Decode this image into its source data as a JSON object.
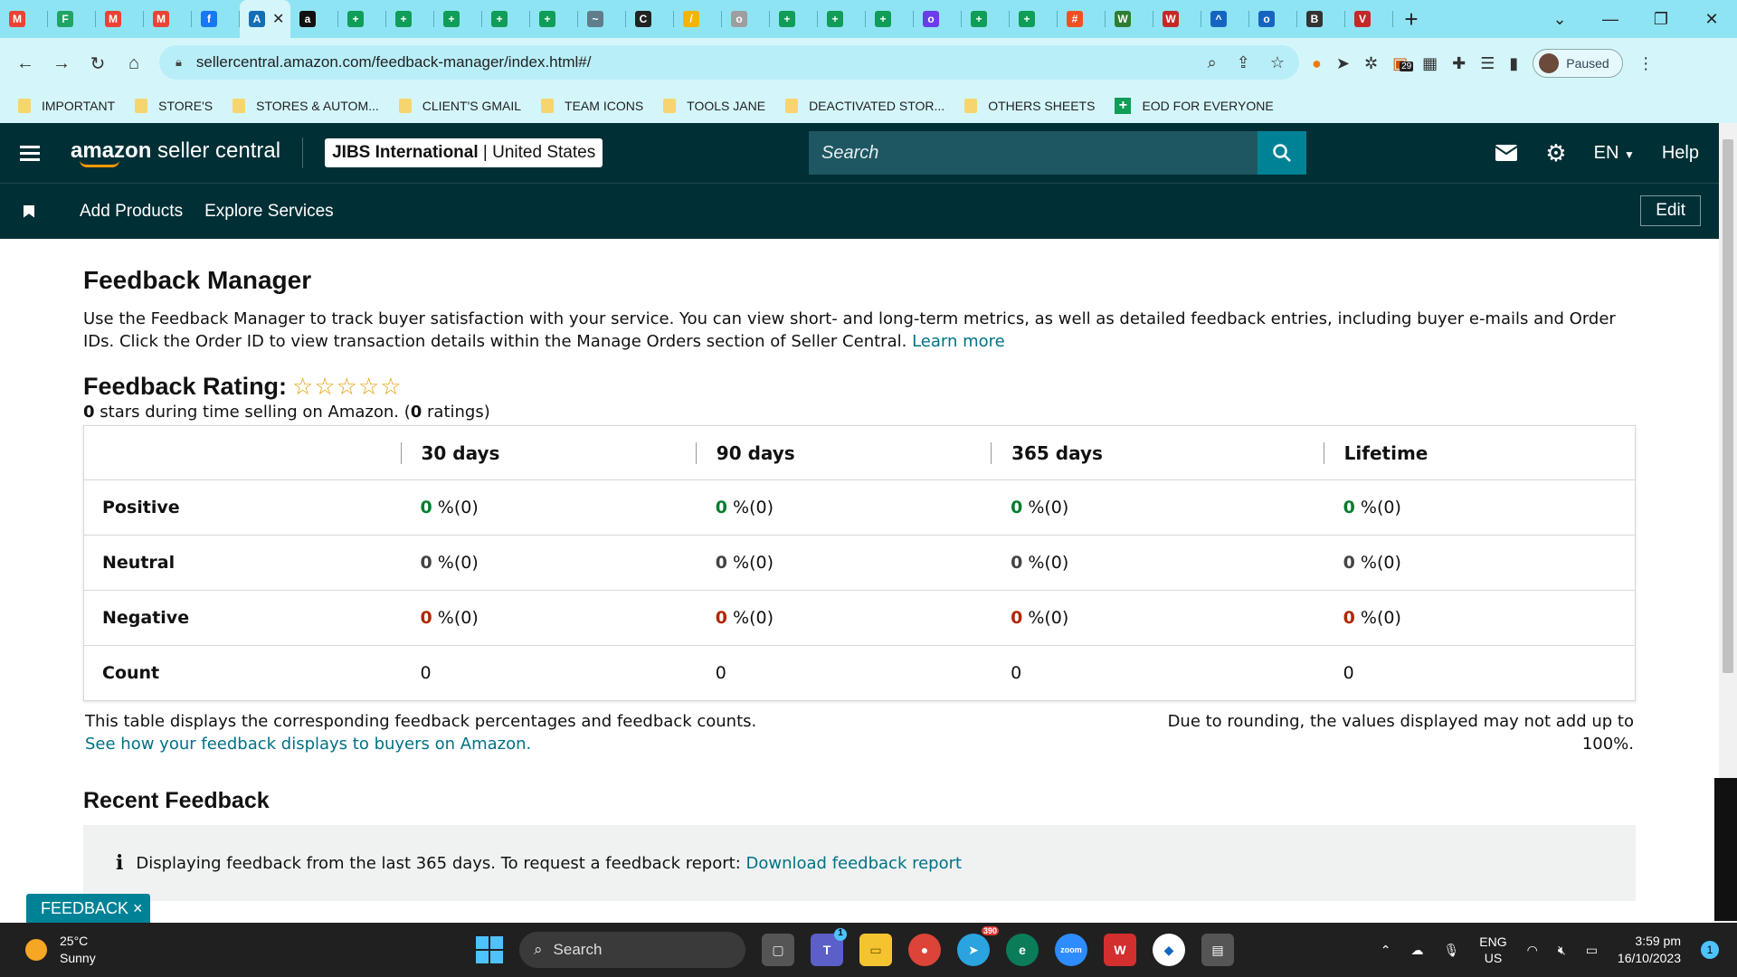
{
  "browser": {
    "tabs": [
      {
        "icon": "gmail-icon",
        "label": "M",
        "color": "#ea4335"
      },
      {
        "icon": "drive-icon",
        "label": "F",
        "color": "#1fa463"
      },
      {
        "icon": "gmail-icon",
        "label": "M",
        "color": "#ea4335"
      },
      {
        "icon": "gmail-icon",
        "label": "M",
        "color": "#ea4335"
      },
      {
        "icon": "facebook-icon",
        "label": "f",
        "color": "#1877f2"
      },
      {
        "icon": "amazon-icon",
        "label": "A",
        "color": "#146eb4",
        "active": true
      },
      {
        "icon": "amazon-a-icon",
        "label": "a",
        "color": "#111111"
      },
      {
        "icon": "sheets-icon",
        "label": "+",
        "color": "#0f9d58"
      },
      {
        "icon": "sheets-icon",
        "label": "+",
        "color": "#0f9d58"
      },
      {
        "icon": "sheets-icon",
        "label": "+",
        "color": "#0f9d58"
      },
      {
        "icon": "sheets-icon",
        "label": "+",
        "color": "#0f9d58"
      },
      {
        "icon": "sheets-icon",
        "label": "+",
        "color": "#0f9d58"
      },
      {
        "icon": "cloud-icon",
        "label": "~",
        "color": "#607d8b"
      },
      {
        "icon": "circle-c-icon",
        "label": "C",
        "color": "#222222"
      },
      {
        "icon": "pen-icon",
        "label": "/",
        "color": "#f4b400"
      },
      {
        "icon": "globe-icon",
        "label": "o",
        "color": "#9e9e9e"
      },
      {
        "icon": "sheets-icon",
        "label": "+",
        "color": "#0f9d58"
      },
      {
        "icon": "sheets-icon",
        "label": "+",
        "color": "#0f9d58"
      },
      {
        "icon": "sheets-icon",
        "label": "+",
        "color": "#0f9d58"
      },
      {
        "icon": "chat-icon",
        "label": "o",
        "color": "#6a3de8"
      },
      {
        "icon": "sheets-icon",
        "label": "+",
        "color": "#0f9d58"
      },
      {
        "icon": "sheets-icon",
        "label": "+",
        "color": "#0f9d58"
      },
      {
        "icon": "microsoft-icon",
        "label": "#",
        "color": "#f25022"
      },
      {
        "icon": "w-icon",
        "label": "W",
        "color": "#2e7d32"
      },
      {
        "icon": "vw-icon",
        "label": "W",
        "color": "#c62828"
      },
      {
        "icon": "cap-icon",
        "label": "^",
        "color": "#1565c0"
      },
      {
        "icon": "eye-icon",
        "label": "o",
        "color": "#1565c0"
      },
      {
        "icon": "b-icon",
        "label": "B",
        "color": "#333333"
      },
      {
        "icon": "v-icon",
        "label": "V",
        "color": "#c62828"
      }
    ],
    "address": {
      "url": "sellercentral.amazon.com/feedback-manager/index.html#/"
    },
    "profile_label": "Paused",
    "ext_badge": "29",
    "bookmarks": [
      {
        "label": "IMPORTANT",
        "type": "folder"
      },
      {
        "label": "STORE'S",
        "type": "folder"
      },
      {
        "label": "STORES & AUTOM...",
        "type": "folder"
      },
      {
        "label": "CLIENT'S GMAIL",
        "type": "folder"
      },
      {
        "label": "TEAM ICONS",
        "type": "folder"
      },
      {
        "label": "TOOLS JANE",
        "type": "folder"
      },
      {
        "label": "DEACTIVATED STOR...",
        "type": "folder"
      },
      {
        "label": "OTHERS SHEETS",
        "type": "folder"
      },
      {
        "label": "EOD FOR EVERYONE",
        "type": "sheet"
      }
    ]
  },
  "header": {
    "logo_bold": "amazon",
    "logo_rest": " seller central",
    "store_name": "JIBS International",
    "store_sep": " | ",
    "store_region": "United States",
    "search_placeholder": "Search",
    "lang": "EN",
    "help": "Help"
  },
  "subnav": {
    "links": [
      "Add Products",
      "Explore Services"
    ],
    "edit": "Edit"
  },
  "page": {
    "title": "Feedback Manager",
    "description": "Use the Feedback Manager to track buyer satisfaction with your service. You can view short- and long-term metrics, as well as detailed feedback entries, including buyer e-mails and Order IDs. Click the Order ID to view transaction details within the Manage Orders section of Seller Central.",
    "learn_more": "Learn more",
    "rating_title": "Feedback Rating:",
    "stars": "☆☆☆☆☆",
    "rating_count_stars": "0",
    "rating_text_mid": " stars during time selling on Amazon. (",
    "rating_count": "0",
    "rating_text_end": " ratings)",
    "table": {
      "columns": [
        "30 days",
        "90 days",
        "365 days",
        "Lifetime"
      ],
      "rows": [
        {
          "label": "Positive",
          "kind": "g",
          "values": [
            {
              "num": "0",
              "rest": " %(0)"
            },
            {
              "num": "0",
              "rest": " %(0)"
            },
            {
              "num": "0",
              "rest": " %(0)"
            },
            {
              "num": "0",
              "rest": " %(0)"
            }
          ]
        },
        {
          "label": "Neutral",
          "kind": "n",
          "values": [
            {
              "num": "0",
              "rest": " %(0)"
            },
            {
              "num": "0",
              "rest": " %(0)"
            },
            {
              "num": "0",
              "rest": " %(0)"
            },
            {
              "num": "0",
              "rest": " %(0)"
            }
          ]
        },
        {
          "label": "Negative",
          "kind": "r",
          "values": [
            {
              "num": "0",
              "rest": " %(0)"
            },
            {
              "num": "0",
              "rest": " %(0)"
            },
            {
              "num": "0",
              "rest": " %(0)"
            },
            {
              "num": "0",
              "rest": " %(0)"
            }
          ]
        },
        {
          "label": "Count",
          "kind": "plain",
          "values": [
            {
              "num": "",
              "rest": "0"
            },
            {
              "num": "",
              "rest": "0"
            },
            {
              "num": "",
              "rest": "0"
            },
            {
              "num": "",
              "rest": "0"
            }
          ]
        }
      ]
    },
    "footnote_left": "This table displays the corresponding feedback percentages and feedback counts.",
    "footnote_link": "See how your feedback displays to buyers on Amazon.",
    "footnote_right": "Due to rounding, the values displayed may not add up to 100%.",
    "recent_title": "Recent Feedback",
    "info_text": "Displaying feedback from the last 365 days. To request a feedback report:",
    "info_link": "Download feedback report",
    "feedback_tab": "FEEDBACK ×"
  },
  "taskbar": {
    "temp": "25°C",
    "weather": "Sunny",
    "search": "Search",
    "telegram_badge": "390",
    "teams_badge": "1",
    "lang_top": "ENG",
    "lang_bottom": "US",
    "time": "3:59 pm",
    "date": "16/10/2023",
    "notif_count": "1"
  },
  "colors": {
    "amazon_dark": "#002f36",
    "teal": "#008296",
    "link": "#007185",
    "positive": "#067d2e",
    "negative": "#b12704"
  }
}
